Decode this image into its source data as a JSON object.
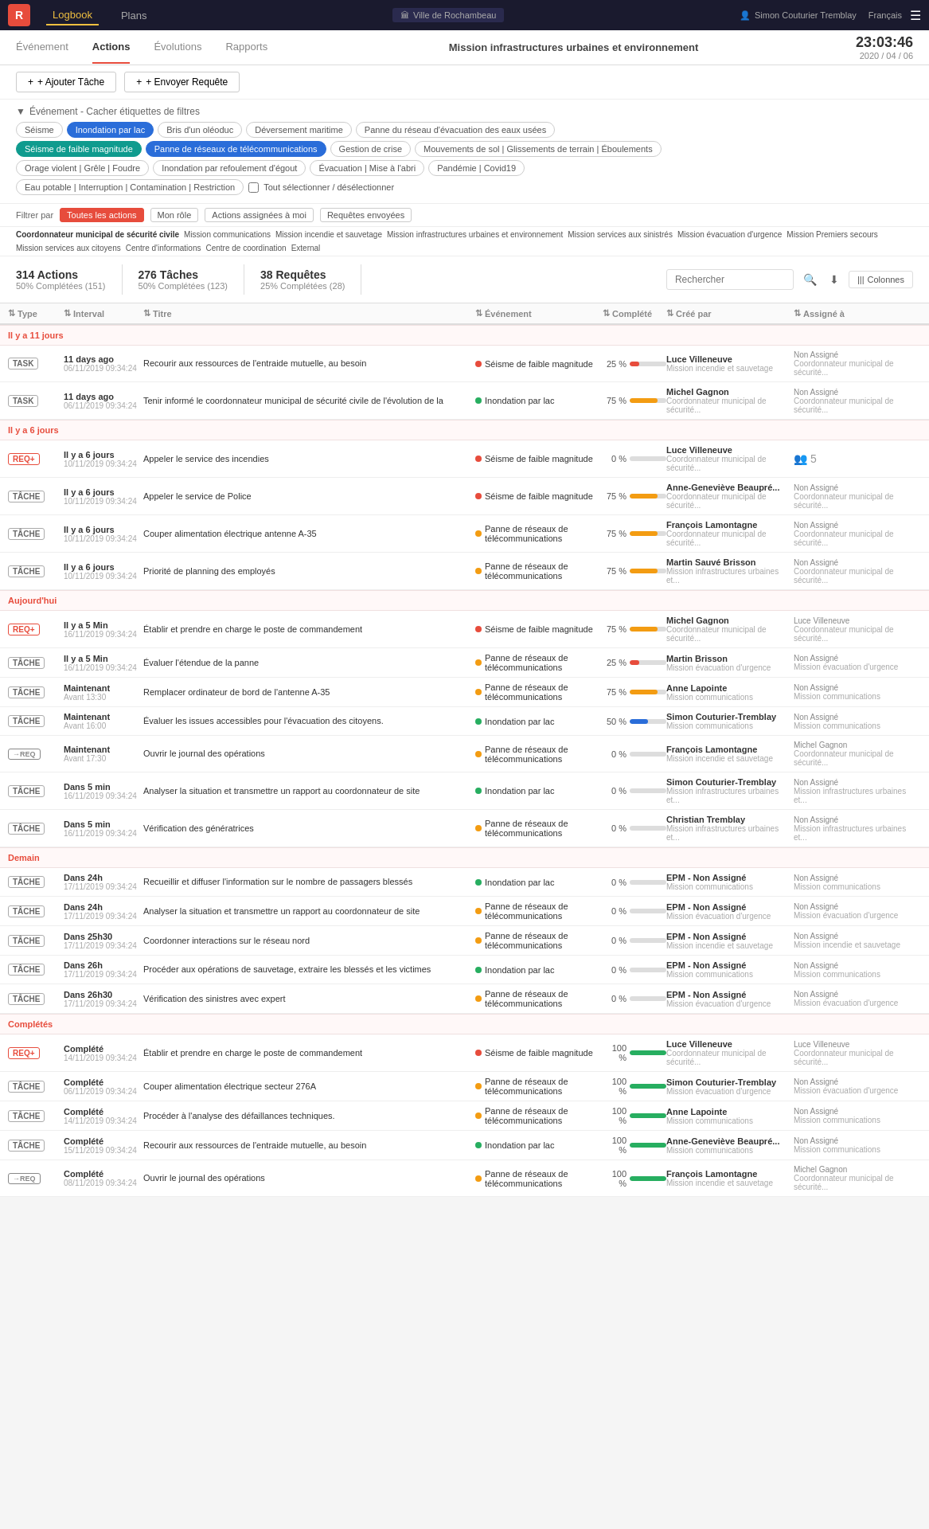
{
  "topNav": {
    "logo": "R",
    "links": [
      {
        "label": "Logbook",
        "active": true
      },
      {
        "label": "Plans",
        "active": false
      }
    ],
    "city": "Ville de Rochambeau",
    "user": "Simon Couturier Tremblay",
    "lang": "Français"
  },
  "secondNav": {
    "tabs": [
      {
        "label": "Événement",
        "active": false
      },
      {
        "label": "Actions",
        "active": true
      },
      {
        "label": "Évolutions",
        "active": false
      },
      {
        "label": "Rapports",
        "active": false
      }
    ],
    "missionTitle": "Mission infrastructures urbaines et environnement",
    "time": "23:03:46",
    "date": "2020 / 04 / 06"
  },
  "actionBar": {
    "addTask": "+ Ajouter Tâche",
    "sendRequest": "+ Envoyer Requête"
  },
  "filterSection": {
    "header": "Événement - Cacher étiquettes de filtres",
    "tags": [
      {
        "label": "Séisme",
        "active": false
      },
      {
        "label": "Inondation par lac",
        "active": true,
        "style": "blue"
      },
      {
        "label": "Bris d'un oléoduc",
        "active": false
      },
      {
        "label": "Déversement maritime",
        "active": false
      },
      {
        "label": "Panne du réseau d'évacuation des eaux usées",
        "active": false
      },
      {
        "label": "Séisme de faible magnitude",
        "active": true,
        "style": "teal"
      },
      {
        "label": "Panne de réseaux de télécommunications",
        "active": true,
        "style": "blue"
      },
      {
        "label": "Gestion de crise",
        "active": false
      },
      {
        "label": "Mouvements de sol | Glissements de terrain | Éboulements",
        "active": false
      },
      {
        "label": "Orage violent | Grêle | Foudre",
        "active": false
      },
      {
        "label": "Inondation par refoulement d'égout",
        "active": false
      },
      {
        "label": "Évacuation | Mise à l'abri",
        "active": false
      },
      {
        "label": "Pandémie | Covid19",
        "active": false
      },
      {
        "label": "Eau potable | Interruption | Contamination | Restriction",
        "active": false
      }
    ],
    "selectAll": "Tout sélectionner / désélectionner"
  },
  "filterBy": {
    "label": "Filtrer par",
    "options": [
      {
        "label": "Toutes les actions",
        "active": true
      },
      {
        "label": "Mon rôle",
        "active": false
      },
      {
        "label": "Actions assignées à moi",
        "active": false
      },
      {
        "label": "Requêtes envoyées",
        "active": false
      }
    ]
  },
  "roleTags": [
    "Coordonnateur municipal de sécurité civile",
    "Mission communications",
    "Mission incendie et sauvetage",
    "Mission infrastructures urbaines et environnement",
    "Mission services aux sinistrés",
    "Mission évacuation d'urgence",
    "Mission Premiers secours",
    "Mission services aux citoyens",
    "Centre d'informations",
    "Centre de coordination",
    "External"
  ],
  "stats": {
    "actions": {
      "label": "314 Actions",
      "sub": "50% Complétées (151)"
    },
    "taches": {
      "label": "276 Tâches",
      "sub": "50% Complétées (123)"
    },
    "requetes": {
      "label": "38 Requêtes",
      "sub": "25% Complétées (28)"
    },
    "searchPlaceholder": "Rechercher",
    "columnsLabel": "Colonnes"
  },
  "tableHeaders": [
    "Type",
    "Interval",
    "Titre",
    "Événement",
    "Complété",
    "Créé par",
    "Assigné à"
  ],
  "sections": [
    {
      "label": "Il y a 11 jours",
      "rows": [
        {
          "type": "TASK",
          "interval": "11 days ago",
          "intervalSub": "06/11/2019 09:34:24",
          "title": "Recourir aux ressources de l'entraide mutuelle, au besoin",
          "titleSub": "",
          "event": "Séisme de faible magnitude",
          "eventColor": "red",
          "pct": 25,
          "pctColor": "red",
          "createdName": "Luce Villeneuve",
          "createdRole": "Mission incendie et sauvetage",
          "assignedName": "Non Assigné",
          "assignedRole": "Coordonnateur municipal de sécurité..."
        },
        {
          "type": "TASK",
          "interval": "11 days ago",
          "intervalSub": "06/11/2019 09:34:24",
          "title": "Tenir informé le coordonnateur municipal de sécurité civile de l'évolution de la",
          "titleSub": "",
          "event": "Inondation par lac",
          "eventColor": "green",
          "pct": 75,
          "pctColor": "orange",
          "createdName": "Michel Gagnon",
          "createdRole": "Coordonnateur municipal de sécurité...",
          "assignedName": "Non Assigné",
          "assignedRole": "Coordonnateur municipal de sécurité..."
        }
      ]
    },
    {
      "label": "Il y a 6 jours",
      "rows": [
        {
          "type": "REQ+",
          "interval": "Il y a 6 jours",
          "intervalSub": "10/11/2019 09:34:24",
          "title": "Appeler le service des incendies",
          "titleSub": "",
          "event": "Séisme de faible magnitude",
          "eventColor": "red",
          "pct": 0,
          "pctColor": "red",
          "createdName": "Luce Villeneuve",
          "createdRole": "Coordonnateur municipal de sécurité...",
          "assignedName": "5",
          "assignedRole": "",
          "hasIcon": true
        },
        {
          "type": "TÂCHE",
          "interval": "Il y a 6 jours",
          "intervalSub": "10/11/2019 09:34:24",
          "title": "Appeler le service de Police",
          "titleSub": "",
          "event": "Séisme de faible magnitude",
          "eventColor": "red",
          "pct": 75,
          "pctColor": "orange",
          "createdName": "Anne-Geneviève Beaupré...",
          "createdRole": "Coordonnateur municipal de sécurité...",
          "assignedName": "Non Assigné",
          "assignedRole": "Coordonnateur municipal de sécurité..."
        },
        {
          "type": "TÂCHE",
          "interval": "Il y a 6 jours",
          "intervalSub": "10/11/2019 09:34:24",
          "title": "Couper alimentation électrique antenne A-35",
          "titleSub": "",
          "event": "Panne de réseaux de télécommunications",
          "eventColor": "orange",
          "pct": 75,
          "pctColor": "orange",
          "createdName": "François Lamontagne",
          "createdRole": "Coordonnateur municipal de sécurité...",
          "assignedName": "Non Assigné",
          "assignedRole": "Coordonnateur municipal de sécurité..."
        },
        {
          "type": "TÂCHE",
          "interval": "Il y a 6 jours",
          "intervalSub": "10/11/2019 09:34:24",
          "title": "Priorité de planning des employés",
          "titleSub": "",
          "event": "Panne de réseaux de télécommunications",
          "eventColor": "orange",
          "pct": 75,
          "pctColor": "orange",
          "createdName": "Martin Sauvé Brisson",
          "createdRole": "Mission infrastructures urbaines et...",
          "assignedName": "Non Assigné",
          "assignedRole": "Coordonnateur municipal de sécurité..."
        }
      ]
    },
    {
      "label": "Aujourd'hui",
      "rows": [
        {
          "type": "REQ+",
          "interval": "Il y a 5 Min",
          "intervalSub": "16/11/2019 09:34:24",
          "title": "Établir et prendre en charge le poste de commandement",
          "titleSub": "",
          "event": "Séisme de faible magnitude",
          "eventColor": "red",
          "pct": 75,
          "pctColor": "orange",
          "createdName": "Michel Gagnon",
          "createdRole": "Coordonnateur municipal de sécurité...",
          "assignedName": "Luce Villeneuve",
          "assignedRole": "Coordonnateur municipal de sécurité..."
        },
        {
          "type": "TÂCHE",
          "interval": "Il y a 5 Min",
          "intervalSub": "16/11/2019 09:34:24",
          "title": "Évaluer l'étendue de la panne",
          "titleSub": "",
          "event": "Panne de réseaux de télécommunications",
          "eventColor": "orange",
          "pct": 25,
          "pctColor": "red",
          "createdName": "Martin Brisson",
          "createdRole": "Mission évacuation d'urgence",
          "assignedName": "Non Assigné",
          "assignedRole": "Mission évacuation d'urgence"
        },
        {
          "type": "TÂCHE",
          "interval": "Maintenant",
          "intervalSub": "Avant 13:30",
          "title": "Remplacer ordinateur de bord de l'antenne A-35",
          "titleSub": "",
          "event": "Panne de réseaux de télécommunications",
          "eventColor": "orange",
          "pct": 75,
          "pctColor": "orange",
          "createdName": "Anne Lapointe",
          "createdRole": "Mission communications",
          "assignedName": "Non Assigné",
          "assignedRole": "Mission communications"
        },
        {
          "type": "TÂCHE",
          "interval": "Maintenant",
          "intervalSub": "Avant 16:00",
          "title": "Évaluer les issues accessibles pour l'évacuation des citoyens.",
          "titleSub": "",
          "event": "Inondation par lac",
          "eventColor": "green",
          "pct": 50,
          "pctColor": "blue",
          "createdName": "Simon Couturier-Tremblay",
          "createdRole": "Mission communications",
          "assignedName": "Non Assigné",
          "assignedRole": "Mission communications"
        },
        {
          "type": "→REQ",
          "interval": "Maintenant",
          "intervalSub": "Avant 17:30",
          "title": "Ouvrir le journal des opérations",
          "titleSub": "",
          "event": "Panne de réseaux de télécommunications",
          "eventColor": "orange",
          "pct": 0,
          "pctColor": "red",
          "createdName": "François Lamontagne",
          "createdRole": "Mission incendie et sauvetage",
          "assignedName": "Michel Gagnon",
          "assignedRole": "Coordonnateur municipal de sécurité..."
        },
        {
          "type": "TÂCHE",
          "interval": "Dans 5 min",
          "intervalSub": "16/11/2019 09:34:24",
          "title": "Analyser la situation et transmettre un rapport au coordonnateur de site",
          "titleSub": "",
          "event": "Inondation par lac",
          "eventColor": "green",
          "pct": 0,
          "pctColor": "red",
          "createdName": "Simon Couturier-Tremblay",
          "createdRole": "Mission infrastructures urbaines et...",
          "assignedName": "Non Assigné",
          "assignedRole": "Mission infrastructures urbaines et..."
        },
        {
          "type": "TÂCHE",
          "interval": "Dans 5 min",
          "intervalSub": "16/11/2019 09:34:24",
          "title": "Vérification des génératrices",
          "titleSub": "",
          "event": "Panne de réseaux de télécommunications",
          "eventColor": "orange",
          "pct": 0,
          "pctColor": "red",
          "createdName": "Christian Tremblay",
          "createdRole": "Mission infrastructures urbaines et...",
          "assignedName": "Non Assigné",
          "assignedRole": "Mission infrastructures urbaines et..."
        }
      ]
    },
    {
      "label": "Demain",
      "rows": [
        {
          "type": "TÂCHE",
          "interval": "Dans 24h",
          "intervalSub": "17/11/2019 09:34:24",
          "title": "Recueillir et diffuser l'information sur le nombre de passagers blessés",
          "titleSub": "",
          "event": "Inondation par lac",
          "eventColor": "green",
          "pct": 0,
          "pctColor": "red",
          "createdName": "EPM - Non Assigné",
          "createdRole": "Mission communications",
          "assignedName": "Non Assigné",
          "assignedRole": "Mission communications"
        },
        {
          "type": "TÂCHE",
          "interval": "Dans 24h",
          "intervalSub": "17/11/2019 09:34:24",
          "title": "Analyser la situation et transmettre un rapport au coordonnateur de site",
          "titleSub": "",
          "event": "Panne de réseaux de télécommunications",
          "eventColor": "orange",
          "pct": 0,
          "pctColor": "red",
          "createdName": "EPM - Non Assigné",
          "createdRole": "Mission évacuation d'urgence",
          "assignedName": "Non Assigné",
          "assignedRole": "Mission évacuation d'urgence"
        },
        {
          "type": "TÂCHE",
          "interval": "Dans 25h30",
          "intervalSub": "17/11/2019 09:34:24",
          "title": "Coordonner interactions sur le réseau nord",
          "titleSub": "",
          "event": "Panne de réseaux de télécommunications",
          "eventColor": "orange",
          "pct": 0,
          "pctColor": "red",
          "createdName": "EPM - Non Assigné",
          "createdRole": "Mission incendie et sauvetage",
          "assignedName": "Non Assigné",
          "assignedRole": "Mission incendie et sauvetage"
        },
        {
          "type": "TÂCHE",
          "interval": "Dans 26h",
          "intervalSub": "17/11/2019 09:34:24",
          "title": "Procéder aux opérations de sauvetage, extraire les blessés et les victimes",
          "titleSub": "",
          "event": "Inondation par lac",
          "eventColor": "green",
          "pct": 0,
          "pctColor": "red",
          "createdName": "EPM - Non Assigné",
          "createdRole": "Mission communications",
          "assignedName": "Non Assigné",
          "assignedRole": "Mission communications"
        },
        {
          "type": "TÂCHE",
          "interval": "Dans 26h30",
          "intervalSub": "17/11/2019 09:34:24",
          "title": "Vérification des sinistres avec expert",
          "titleSub": "",
          "event": "Panne de réseaux de télécommunications",
          "eventColor": "orange",
          "pct": 0,
          "pctColor": "red",
          "createdName": "EPM - Non Assigné",
          "createdRole": "Mission évacuation d'urgence",
          "assignedName": "Non Assigné",
          "assignedRole": "Mission évacuation d'urgence"
        }
      ]
    },
    {
      "label": "Complétés",
      "rows": [
        {
          "type": "REQ+",
          "interval": "Complété",
          "intervalSub": "14/11/2019 09:34:24",
          "title": "Établir et prendre en charge le poste de commandement",
          "titleSub": "",
          "event": "Séisme de faible magnitude",
          "eventColor": "red",
          "pct": 100,
          "pctColor": "green",
          "createdName": "Luce Villeneuve",
          "createdRole": "Coordonnateur municipal de sécurité...",
          "assignedName": "Luce Villeneuve",
          "assignedRole": "Coordonnateur municipal de sécurité..."
        },
        {
          "type": "TÂCHE",
          "interval": "Complété",
          "intervalSub": "06/11/2019 09:34:24",
          "title": "Couper alimentation électrique secteur 276A",
          "titleSub": "",
          "event": "Panne de réseaux de télécommunications",
          "eventColor": "orange",
          "pct": 100,
          "pctColor": "green",
          "createdName": "Simon Couturier-Tremblay",
          "createdRole": "Mission évacuation d'urgence",
          "assignedName": "Non Assigné",
          "assignedRole": "Mission évacuation d'urgence"
        },
        {
          "type": "TÂCHE",
          "interval": "Complété",
          "intervalSub": "14/11/2019 09:34:24",
          "title": "Procéder à l'analyse des défaillances techniques.",
          "titleSub": "",
          "event": "Panne de réseaux de télécommunications",
          "eventColor": "orange",
          "pct": 100,
          "pctColor": "green",
          "createdName": "Anne Lapointe",
          "createdRole": "Mission communications",
          "assignedName": "Non Assigné",
          "assignedRole": "Mission communications"
        },
        {
          "type": "TÂCHE",
          "interval": "Complété",
          "intervalSub": "15/11/2019 09:34:24",
          "title": "Recourir aux ressources de l'entraide mutuelle, au besoin",
          "titleSub": "",
          "event": "Inondation par lac",
          "eventColor": "green",
          "pct": 100,
          "pctColor": "green",
          "createdName": "Anne-Geneviève Beaupré...",
          "createdRole": "Mission communications",
          "assignedName": "Non Assigné",
          "assignedRole": "Mission communications"
        },
        {
          "type": "→REQ",
          "interval": "Complété",
          "intervalSub": "08/11/2019 09:34:24",
          "title": "Ouvrir le journal des opérations",
          "titleSub": "",
          "event": "Panne de réseaux de télécommunications",
          "eventColor": "orange",
          "pct": 100,
          "pctColor": "green",
          "createdName": "François Lamontagne",
          "createdRole": "Mission incendie et sauvetage",
          "assignedName": "Michel Gagnon",
          "assignedRole": "Coordonnateur municipal de sécurité..."
        }
      ]
    }
  ]
}
